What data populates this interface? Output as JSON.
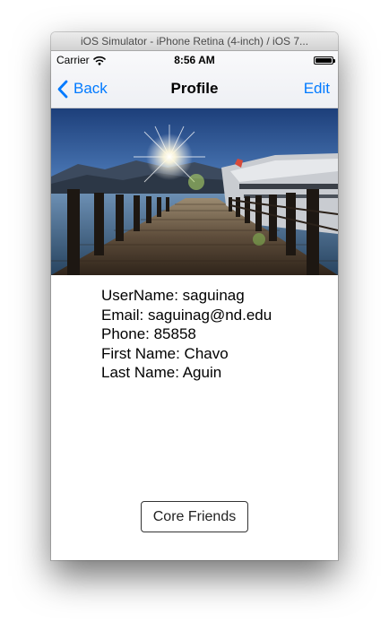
{
  "window": {
    "title": "iOS Simulator - iPhone Retina (4-inch) / iOS 7..."
  },
  "status_bar": {
    "carrier": "Carrier",
    "time": "8:56 AM",
    "wifi_icon": "wifi-icon",
    "battery_icon": "battery-icon",
    "battery_level": 1.0
  },
  "nav": {
    "back_label": "Back",
    "back_icon": "chevron-left-icon",
    "title": "Profile",
    "edit_label": "Edit",
    "tint_color": "#007aff"
  },
  "profile": {
    "photo": "pier-sunset-photo",
    "lines": [
      "UserName: saguinag",
      "Email: saguinag@nd.edu",
      "Phone: 85858",
      "First Name: Chavo",
      "Last Name: Aguin"
    ]
  },
  "actions": {
    "core_friends_label": "Core Friends"
  }
}
